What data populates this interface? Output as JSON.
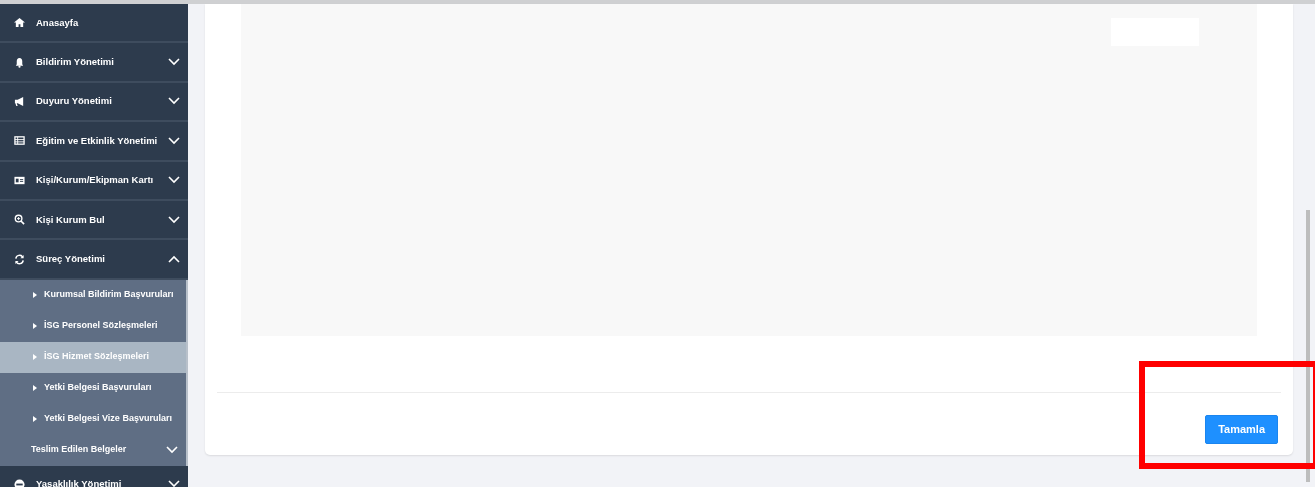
{
  "sidebar": {
    "items": [
      {
        "label": "Anasayfa",
        "kind": "link"
      },
      {
        "label": "Bildirim Yönetimi",
        "kind": "menu",
        "expanded": false
      },
      {
        "label": "Duyuru Yönetimi",
        "kind": "menu",
        "expanded": false
      },
      {
        "label": "Eğitim ve Etkinlik Yönetimi",
        "kind": "menu",
        "expanded": false
      },
      {
        "label": "Kişi/Kurum/Ekipman Kartı",
        "kind": "menu",
        "expanded": false
      },
      {
        "label": "Kişi Kurum Bul",
        "kind": "menu",
        "expanded": false
      },
      {
        "label": "Süreç Yönetimi",
        "kind": "menu",
        "expanded": true,
        "children": [
          {
            "label": "Kurumsal Bildirim Başvuruları",
            "kind": "link",
            "selected": false
          },
          {
            "label": "İSG Personel Sözleşmeleri",
            "kind": "link",
            "selected": false
          },
          {
            "label": "İSG Hizmet Sözleşmeleri",
            "kind": "link",
            "selected": true
          },
          {
            "label": "Yetki Belgesi Başvuruları",
            "kind": "link",
            "selected": false
          },
          {
            "label": "Yetki Belgesi Vize Başvuruları",
            "kind": "link",
            "selected": false
          },
          {
            "label": "Teslim Edilen Belgeler",
            "kind": "group",
            "expanded": false
          }
        ]
      },
      {
        "label": "Yasaklılık Yönetimi",
        "kind": "menu",
        "expanded": false
      }
    ]
  },
  "footer": {
    "button": "Tamamla"
  }
}
